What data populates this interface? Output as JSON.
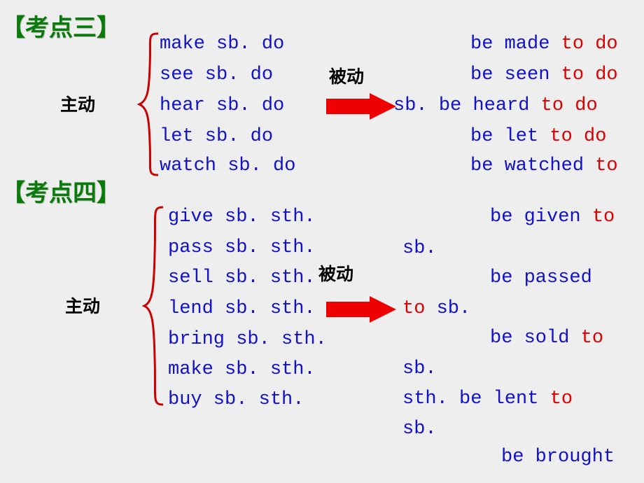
{
  "slide": {
    "background_color": "#eeeeee",
    "headings": [
      {
        "id": "heading-3",
        "text": "【考点三】"
      },
      {
        "id": "heading-4",
        "text": "【考点四】"
      }
    ],
    "labels": {
      "active_1": "主动",
      "passive_1": "被动",
      "active_2": "主动",
      "passive_2": "被动"
    },
    "block1": {
      "left_lines": [
        "make sb. do",
        "see sb. do",
        "hear sb. do",
        "let sb. do",
        "watch sb. do"
      ],
      "right_lines": [
        {
          "prefix": "",
          "main": "be made ",
          "accent": "to do"
        },
        {
          "prefix": "",
          "main": "be seen ",
          "accent": "to do"
        },
        {
          "prefix": "sb. ",
          "main": "be heard ",
          "accent": "to do"
        },
        {
          "prefix": "",
          "main": "be let ",
          "accent": "to do"
        },
        {
          "prefix": "",
          "main": "be watched ",
          "accent": "to"
        }
      ]
    },
    "block2": {
      "left_lines": [
        "give sb. sth.",
        "pass sb. sth.",
        "sell sb. sth.",
        "lend sb. sth.",
        "bring sb. sth.",
        "make sb. sth.",
        "buy sb. sth."
      ],
      "right_lines": [
        {
          "prefix": "",
          "main": "be given ",
          "accent": "to"
        },
        {
          "prefix": "sb.",
          "main": "",
          "accent": ""
        },
        {
          "prefix": "",
          "main": "be passed",
          "accent": ""
        },
        {
          "prefix": "",
          "main": "",
          "accent": "to",
          "suffix": " sb."
        },
        {
          "prefix": "",
          "main": "be sold ",
          "accent": "to"
        },
        {
          "prefix": "sb.",
          "main": "",
          "accent": ""
        },
        {
          "prefix": "sth. ",
          "main": "be lent ",
          "accent": "to"
        },
        {
          "prefix": "sb.",
          "main": "",
          "accent": ""
        },
        {
          "prefix": "",
          "main": "be brought",
          "accent": ""
        }
      ]
    },
    "colors": {
      "heading_green": "#0a7a0a",
      "text_blue": "#1111cc",
      "accent_red": "#dd0000",
      "brace_red": "#cc0000",
      "arrow_red": "#ee0000"
    }
  }
}
